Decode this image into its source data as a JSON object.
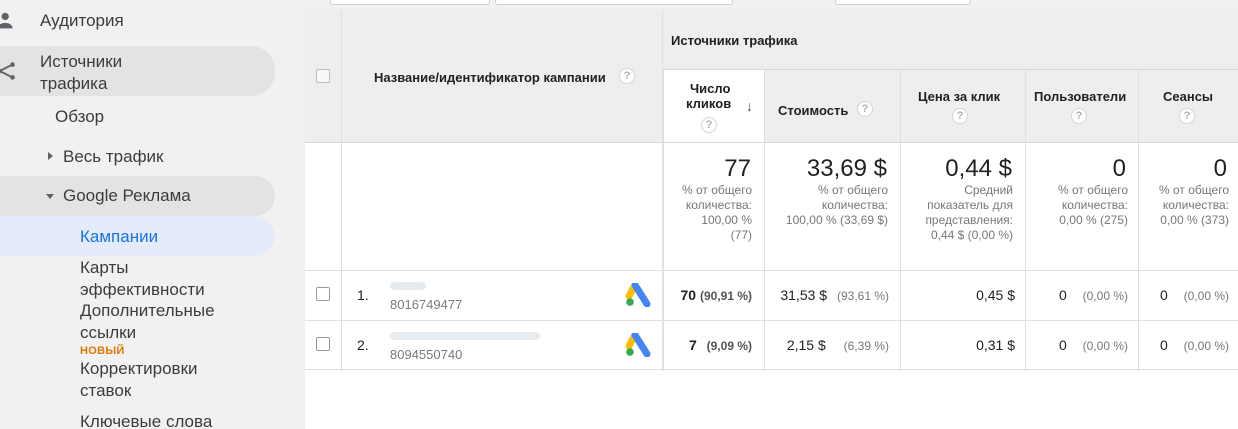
{
  "sidebar": {
    "audience": "Аудитория",
    "acquisition_line1": "Источники",
    "acquisition_line2": "трафика",
    "overview": "Обзор",
    "all_traffic": "Весь трафик",
    "google_ads": "Google Реклама",
    "campaigns": "Кампании",
    "treemaps_line1": "Карты",
    "treemaps_line2": "эффективности",
    "sitelinks_line1": "Дополнительные",
    "sitelinks_line2": "ссылки",
    "new_badge": "НОВЫЙ",
    "bid_adj_line1": "Корректировки",
    "bid_adj_line2": "ставок",
    "keywords": "Ключевые слова"
  },
  "table": {
    "group_header": "Источники трафика",
    "col_campaign": "Название/идентификатор кампании",
    "col_clicks_line1": "Число",
    "col_clicks_line2": "кликов",
    "col_cost": "Стоимость",
    "col_cpc": "Цена за клик",
    "col_users": "Пользователи",
    "col_sessions": "Сеансы",
    "help_glyph": "?",
    "sort_glyph": "↓",
    "totals": {
      "clicks": "77",
      "clicks_sub1": "% от общего",
      "clicks_sub2": "количества:",
      "clicks_sub3": "100,00 %",
      "clicks_sub4": "(77)",
      "cost": "33,69 $",
      "cost_sub1": "% от общего",
      "cost_sub2": "количества:",
      "cost_sub3": "100,00 % (33,69 $)",
      "cpc": "0,44 $",
      "cpc_sub1": "Средний",
      "cpc_sub2": "показатель для",
      "cpc_sub3": "представления:",
      "cpc_sub4": "0,44 $ (0,00 %)",
      "users": "0",
      "users_sub1": "% от общего",
      "users_sub2": "количества:",
      "users_sub3": "0,00 % (275)",
      "sessions": "0",
      "sessions_sub1": "% от общего",
      "sessions_sub2": "количества:",
      "sessions_sub3": "0,00 % (373)"
    },
    "rows": [
      {
        "num": "1.",
        "id": "8016749477",
        "clicks": "70",
        "clicks_pct": "(90,91 %)",
        "cost": "31,53 $",
        "cost_pct": "(93,61 %)",
        "cpc": "0,45 $",
        "users": "0",
        "users_pct": "(0,00 %)",
        "sessions": "0",
        "sessions_pct": "(0,00 %)"
      },
      {
        "num": "2.",
        "id": "8094550740",
        "clicks": "7",
        "clicks_pct": "(9,09 %)",
        "cost": "2,15 $",
        "cost_pct": "(6,39 %)",
        "cpc": "0,31 $",
        "users": "0",
        "users_pct": "(0,00 %)",
        "sessions": "0",
        "sessions_pct": "(0,00 %)"
      }
    ]
  },
  "colors": {
    "accent": "#1a73e8",
    "badge": "#e37400",
    "ads_blue": "#4285f4",
    "ads_yellow": "#fbbc04",
    "ads_green": "#34a853"
  }
}
